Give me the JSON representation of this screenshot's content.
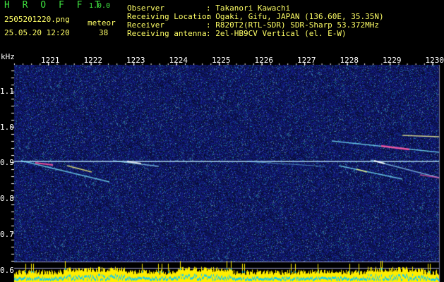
{
  "app": {
    "title": "H R O F F T",
    "version": "1.0.0"
  },
  "file": {
    "name": "2505201220.png",
    "datetime": "25.05.20 12:20"
  },
  "meteor": {
    "label": "meteor",
    "count": "38"
  },
  "info": {
    "observer_label": "Observer",
    "observer_value": ": Takanori Kawachi",
    "location_label": "Receiving Location",
    "location_value": ": Ogaki, Gifu, JAPAN (136.60E, 35.35N)",
    "receiver_label": "Receiver",
    "receiver_value": ": R820T2(RTL-SDR) SDR-Sharp 53.372MHz",
    "antenna_label": "Receiving antenna",
    "antenna_value": ": 2el-HB9CV Vertical (el. E-W)"
  },
  "axis": {
    "unit": "kHz",
    "time_ticks": [
      "1221",
      "1222",
      "1223",
      "1224",
      "1225",
      "1226",
      "1227",
      "1228",
      "1229",
      "1230"
    ],
    "freq_ticks": [
      "1.1",
      "1.0",
      "0.9",
      "0.8",
      "0.7",
      "0.6"
    ]
  },
  "colors": {
    "background": "#000000",
    "noise": "#1a1a8c",
    "carrier": "#ffffff",
    "echo": "#ff66aa",
    "spectrum": "#ffee00",
    "header_text": "#ffff66",
    "title": "#3fe03f"
  }
}
